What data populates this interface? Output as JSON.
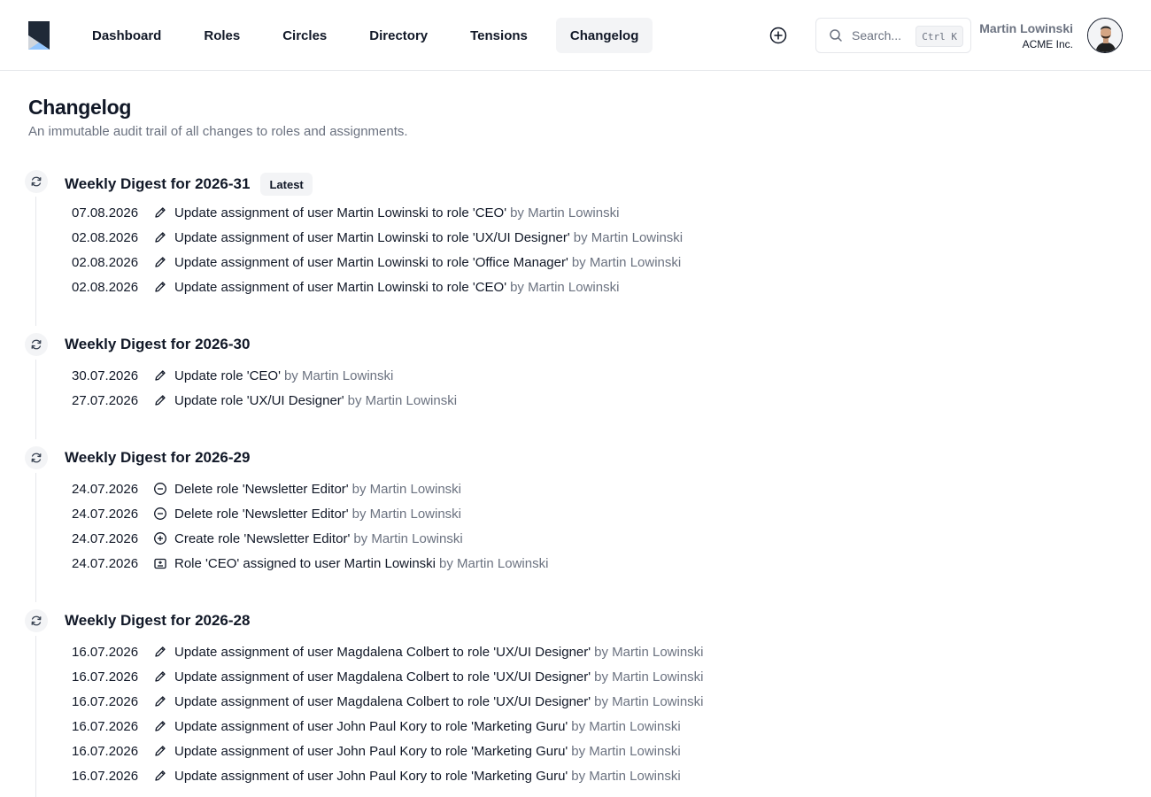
{
  "nav": {
    "items": [
      {
        "label": "Dashboard",
        "active": false
      },
      {
        "label": "Roles",
        "active": false
      },
      {
        "label": "Circles",
        "active": false
      },
      {
        "label": "Directory",
        "active": false
      },
      {
        "label": "Tensions",
        "active": false
      },
      {
        "label": "Changelog",
        "active": true
      }
    ]
  },
  "search": {
    "placeholder": "Search...",
    "shortcut": "Ctrl K"
  },
  "user": {
    "name": "Martin Lowinski",
    "org": "ACME Inc."
  },
  "page": {
    "title": "Changelog",
    "subtitle": "An immutable audit trail of all changes to roles and assignments."
  },
  "digests": [
    {
      "title": "Weekly Digest for 2026-31",
      "badge": "Latest",
      "entries": [
        {
          "date": "07.08.2026",
          "icon": "pencil-icon",
          "text": "Update assignment of user Martin Lowinski to role 'CEO'",
          "by": "by Martin Lowinski"
        },
        {
          "date": "02.08.2026",
          "icon": "pencil-icon",
          "text": "Update assignment of user Martin Lowinski to role 'UX/UI Designer'",
          "by": "by Martin Lowinski"
        },
        {
          "date": "02.08.2026",
          "icon": "pencil-icon",
          "text": "Update assignment of user Martin Lowinski to role 'Office Manager'",
          "by": "by Martin Lowinski"
        },
        {
          "date": "02.08.2026",
          "icon": "pencil-icon",
          "text": "Update assignment of user Martin Lowinski to role 'CEO'",
          "by": "by Martin Lowinski"
        }
      ]
    },
    {
      "title": "Weekly Digest for 2026-30",
      "badge": "",
      "entries": [
        {
          "date": "30.07.2026",
          "icon": "pencil-icon",
          "text": "Update role 'CEO'",
          "by": "by Martin Lowinski"
        },
        {
          "date": "27.07.2026",
          "icon": "pencil-icon",
          "text": "Update role 'UX/UI Designer'",
          "by": "by Martin Lowinski"
        }
      ]
    },
    {
      "title": "Weekly Digest for 2026-29",
      "badge": "",
      "entries": [
        {
          "date": "24.07.2026",
          "icon": "minus-circle-icon",
          "text": "Delete role 'Newsletter Editor'",
          "by": "by Martin Lowinski"
        },
        {
          "date": "24.07.2026",
          "icon": "minus-circle-icon",
          "text": "Delete role 'Newsletter Editor'",
          "by": "by Martin Lowinski"
        },
        {
          "date": "24.07.2026",
          "icon": "plus-circle-icon",
          "text": "Create role 'Newsletter Editor'",
          "by": "by Martin Lowinski"
        },
        {
          "date": "24.07.2026",
          "icon": "assign-icon",
          "text": "Role 'CEO' assigned to user Martin Lowinski",
          "by": "by Martin Lowinski"
        }
      ]
    },
    {
      "title": "Weekly Digest for 2026-28",
      "badge": "",
      "entries": [
        {
          "date": "16.07.2026",
          "icon": "pencil-icon",
          "text": "Update assignment of user Magdalena Colbert to role 'UX/UI Designer'",
          "by": "by Martin Lowinski"
        },
        {
          "date": "16.07.2026",
          "icon": "pencil-icon",
          "text": "Update assignment of user Magdalena Colbert to role 'UX/UI Designer'",
          "by": "by Martin Lowinski"
        },
        {
          "date": "16.07.2026",
          "icon": "pencil-icon",
          "text": "Update assignment of user Magdalena Colbert to role 'UX/UI Designer'",
          "by": "by Martin Lowinski"
        },
        {
          "date": "16.07.2026",
          "icon": "pencil-icon",
          "text": "Update assignment of user John Paul Kory to role 'Marketing Guru'",
          "by": "by Martin Lowinski"
        },
        {
          "date": "16.07.2026",
          "icon": "pencil-icon",
          "text": "Update assignment of user John Paul Kory to role 'Marketing Guru'",
          "by": "by Martin Lowinski"
        },
        {
          "date": "16.07.2026",
          "icon": "pencil-icon",
          "text": "Update assignment of user John Paul Kory to role 'Marketing Guru'",
          "by": "by Martin Lowinski"
        }
      ]
    }
  ]
}
